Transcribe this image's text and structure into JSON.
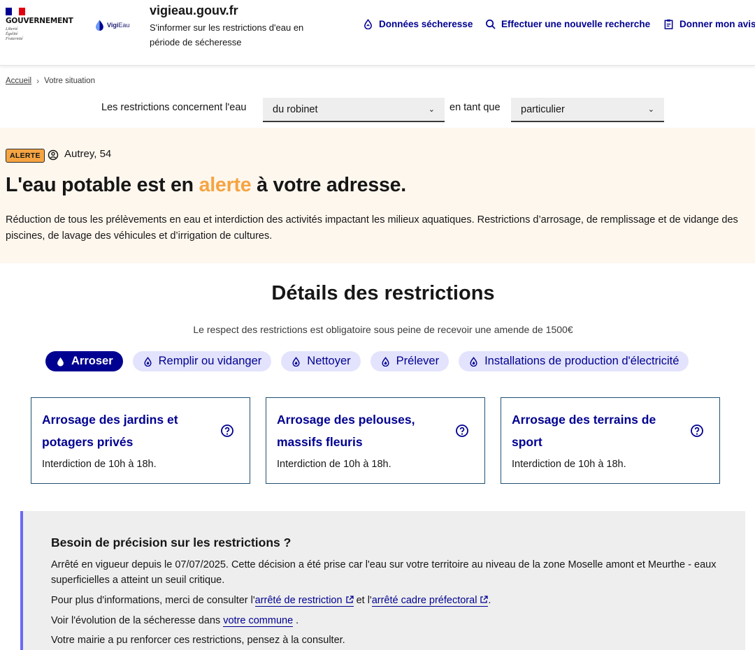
{
  "header": {
    "gov_name": "GOUVERNEMENT",
    "motto": [
      "Liberté",
      "Égalité",
      "Fraternité"
    ],
    "brand_prefix": "Vigi",
    "brand_suffix": "Eau",
    "site_name": "vigieau.gouv.fr",
    "tagline": "S'informer sur les restrictions d'eau en période de sécheresse",
    "nav": [
      {
        "label": "Données sécheresse",
        "icon": "drought-data-icon"
      },
      {
        "label": "Effectuer une nouvelle recherche",
        "icon": "search-icon"
      },
      {
        "label": "Donner mon avis",
        "icon": "clipboard-icon"
      }
    ]
  },
  "breadcrumb": {
    "home": "Accueil",
    "current": "Votre situation"
  },
  "filters": {
    "label_before": "Les restrictions concernent l'eau",
    "water_type": "du robinet",
    "label_middle": "en tant que",
    "profile": "particulier"
  },
  "alert": {
    "badge": "ALERTE",
    "location": "Autrey, 54",
    "headline_before": "L'eau potable est en ",
    "headline_level": "alerte",
    "headline_after": " à votre adresse.",
    "description": "Réduction de tous les prélèvements en eau et interdiction des activités impactant les milieux aquatiques. Restrictions d’arrosage, de remplissage et de vidange des piscines, de lavage des véhicules et d’irrigation de cultures.",
    "level_color": "#f6a441"
  },
  "details": {
    "title": "Détails des restrictions",
    "fine": "Le respect des restrictions est obligatoire sous peine de recevoir une amende de 1500€",
    "tabs": [
      {
        "label": "Arroser",
        "active": true
      },
      {
        "label": "Remplir ou vidanger",
        "active": false
      },
      {
        "label": "Nettoyer",
        "active": false
      },
      {
        "label": "Prélever",
        "active": false
      },
      {
        "label": "Installations de production d'électricité",
        "active": false
      }
    ],
    "cards": [
      {
        "title": "Arrosage des jardins et potagers privés",
        "desc": "Interdiction de 10h à 18h."
      },
      {
        "title": "Arrosage des pelouses, massifs fleuris",
        "desc": "Interdiction de 10h à 18h."
      },
      {
        "title": "Arrosage des terrains de sport",
        "desc": "Interdiction de 10h à 18h."
      }
    ]
  },
  "info": {
    "title": "Besoin de précision sur les restrictions ?",
    "p1": "Arrêté en vigueur depuis le 07/07/2025. Cette décision a été prise car l'eau sur votre territoire au niveau de la zone Moselle amont et Meurthe - eaux superficielles a atteint un seuil critique.",
    "p2_before": "Pour plus d'informations, merci de consulter l'",
    "p2_link1": "arrêté de restriction",
    "p2_middle": " et l'",
    "p2_link2": "arrêté cadre préfectoral",
    "p2_after": ".",
    "p3_before": "Voir l'évolution de la sécheresse dans ",
    "p3_link": "votre commune",
    "p3_after": " .",
    "p4": "Votre mairie a pu renforcer ces restrictions, pensez à la consulter."
  },
  "colors": {
    "primary": "#000091",
    "alert_band": "#fef7ee",
    "tab_inactive": "#e3e3fd",
    "info_border": "#6a6af4"
  }
}
